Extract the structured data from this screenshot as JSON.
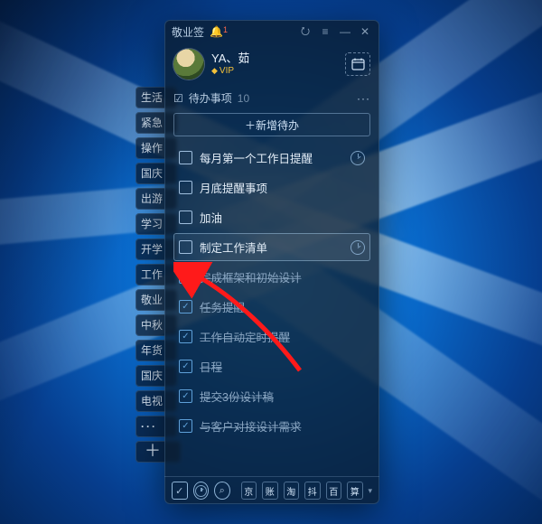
{
  "app": {
    "title": "敬业签",
    "notification_count": "1"
  },
  "user": {
    "name": "YA、茹",
    "vip": "VIP"
  },
  "section": {
    "title": "待办事项",
    "count": "10"
  },
  "add_button": "＋新增待办",
  "todos": [
    {
      "label": "每月第一个工作日提醒",
      "done": false,
      "selected": false,
      "clock": true
    },
    {
      "label": "月底提醒事项",
      "done": false,
      "selected": false,
      "clock": false
    },
    {
      "label": "加油",
      "done": false,
      "selected": false,
      "clock": false
    },
    {
      "label": "制定工作清单",
      "done": false,
      "selected": true,
      "clock": true
    },
    {
      "label": "完成框架和初始设计",
      "done": true,
      "selected": false,
      "clock": false
    },
    {
      "label": "任务提醒",
      "done": true,
      "selected": false,
      "clock": false
    },
    {
      "label": "工作自动定时提醒",
      "done": true,
      "selected": false,
      "clock": false
    },
    {
      "label": "日程",
      "done": true,
      "selected": false,
      "clock": false
    },
    {
      "label": "提交3份设计稿",
      "done": true,
      "selected": false,
      "clock": false
    },
    {
      "label": "与客户对接设计需求",
      "done": true,
      "selected": false,
      "clock": false
    }
  ],
  "side_tabs": [
    "生活",
    "紧急",
    "操作",
    "国庆",
    "出游",
    "学习",
    "开学",
    "工作",
    "敬业",
    "中秋",
    "年货",
    "国庆",
    "电视"
  ],
  "bottom_chips": [
    "京",
    "账",
    "淘",
    "抖",
    "百",
    "算"
  ],
  "icons": {
    "cloud": "⭮",
    "menu": "≡",
    "min": "—",
    "close": "✕",
    "calendar": "📅",
    "check_sq": "✓",
    "clock": "",
    "search": "⌕",
    "dots": "···",
    "caret": "▾",
    "pin": "☑"
  }
}
